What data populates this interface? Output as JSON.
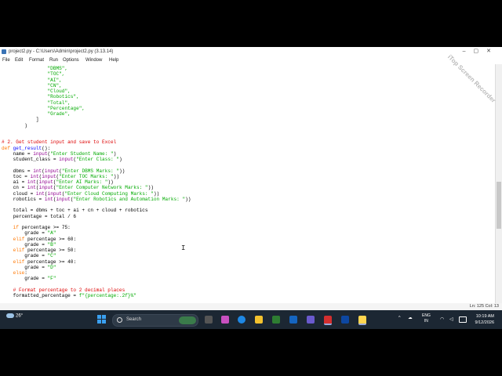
{
  "window": {
    "title": "project2.py - C:\\Users\\Admin\\project2.py (3.13.14)"
  },
  "menu": [
    "File",
    "Edit",
    "Format",
    "Run",
    "Options",
    "Window",
    "Help"
  ],
  "watermark": "iTop Screen Recorder",
  "code": [
    [
      {
        "t": "                \"DBMS\",",
        "c": "str"
      }
    ],
    [
      {
        "t": "                \"TOC\",",
        "c": "str"
      }
    ],
    [
      {
        "t": "                \"AI\",",
        "c": "str"
      }
    ],
    [
      {
        "t": "                \"CN\",",
        "c": "str"
      }
    ],
    [
      {
        "t": "                \"Cloud\",",
        "c": "str"
      }
    ],
    [
      {
        "t": "                \"Robotics\",",
        "c": "str"
      }
    ],
    [
      {
        "t": "                \"Total\",",
        "c": "str"
      }
    ],
    [
      {
        "t": "                \"Percentage\",",
        "c": "str"
      }
    ],
    [
      {
        "t": "                \"Grade\",",
        "c": "str"
      }
    ],
    [
      {
        "t": "            ]",
        "c": ""
      }
    ],
    [
      {
        "t": "        )",
        "c": ""
      }
    ],
    [
      {
        "t": "",
        "c": ""
      }
    ],
    [
      {
        "t": "",
        "c": ""
      }
    ],
    [
      {
        "t": "# 2. Get student input and save to Excel",
        "c": "cmt"
      }
    ],
    [
      {
        "t": "def ",
        "c": "kw"
      },
      {
        "t": "get_result",
        "c": "def"
      },
      {
        "t": "():",
        "c": ""
      }
    ],
    [
      {
        "t": "    name = ",
        "c": ""
      },
      {
        "t": "input",
        "c": "bi"
      },
      {
        "t": "(",
        "c": ""
      },
      {
        "t": "\"Enter Student Name: \"",
        "c": "str"
      },
      {
        "t": ")",
        "c": ""
      }
    ],
    [
      {
        "t": "    student_class = ",
        "c": ""
      },
      {
        "t": "input",
        "c": "bi"
      },
      {
        "t": "(",
        "c": ""
      },
      {
        "t": "\"Enter Class: \"",
        "c": "str"
      },
      {
        "t": ")",
        "c": ""
      }
    ],
    [
      {
        "t": "",
        "c": ""
      }
    ],
    [
      {
        "t": "    dbms = ",
        "c": ""
      },
      {
        "t": "int",
        "c": "bi"
      },
      {
        "t": "(",
        "c": ""
      },
      {
        "t": "input",
        "c": "bi"
      },
      {
        "t": "(",
        "c": ""
      },
      {
        "t": "\"Enter DBMS Marks: \"",
        "c": "str"
      },
      {
        "t": "))",
        "c": ""
      }
    ],
    [
      {
        "t": "    toc = ",
        "c": ""
      },
      {
        "t": "int",
        "c": "bi"
      },
      {
        "t": "(",
        "c": ""
      },
      {
        "t": "input",
        "c": "bi"
      },
      {
        "t": "(",
        "c": ""
      },
      {
        "t": "\"Enter TOC Marks: \"",
        "c": "str"
      },
      {
        "t": "))",
        "c": ""
      }
    ],
    [
      {
        "t": "    ai = ",
        "c": ""
      },
      {
        "t": "int",
        "c": "bi"
      },
      {
        "t": "(",
        "c": ""
      },
      {
        "t": "input",
        "c": "bi"
      },
      {
        "t": "(",
        "c": ""
      },
      {
        "t": "\"Enter AI Marks: \"",
        "c": "str"
      },
      {
        "t": "))",
        "c": ""
      }
    ],
    [
      {
        "t": "    cn = ",
        "c": ""
      },
      {
        "t": "int",
        "c": "bi"
      },
      {
        "t": "(",
        "c": ""
      },
      {
        "t": "input",
        "c": "bi"
      },
      {
        "t": "(",
        "c": ""
      },
      {
        "t": "\"Enter Computer Network Marks: \"",
        "c": "str"
      },
      {
        "t": "))",
        "c": ""
      }
    ],
    [
      {
        "t": "    cloud = ",
        "c": ""
      },
      {
        "t": "int",
        "c": "bi"
      },
      {
        "t": "(",
        "c": ""
      },
      {
        "t": "input",
        "c": "bi"
      },
      {
        "t": "(",
        "c": ""
      },
      {
        "t": "\"Enter Cloud Computing Marks: \"",
        "c": "str"
      },
      {
        "t": "))",
        "c": ""
      }
    ],
    [
      {
        "t": "    robotics = ",
        "c": ""
      },
      {
        "t": "int",
        "c": "bi"
      },
      {
        "t": "(",
        "c": ""
      },
      {
        "t": "input",
        "c": "bi"
      },
      {
        "t": "(",
        "c": ""
      },
      {
        "t": "\"Enter Robotics and Automation Marks: \"",
        "c": "str"
      },
      {
        "t": "))",
        "c": ""
      }
    ],
    [
      {
        "t": "",
        "c": ""
      }
    ],
    [
      {
        "t": "    total = dbms + toc + ai + cn + cloud + robotics",
        "c": ""
      }
    ],
    [
      {
        "t": "    percentage = total / 6",
        "c": ""
      }
    ],
    [
      {
        "t": "",
        "c": ""
      }
    ],
    [
      {
        "t": "    ",
        "c": ""
      },
      {
        "t": "if",
        "c": "kw"
      },
      {
        "t": " percentage >= 75:",
        "c": ""
      }
    ],
    [
      {
        "t": "        grade = ",
        "c": ""
      },
      {
        "t": "\"A\"",
        "c": "str"
      }
    ],
    [
      {
        "t": "    ",
        "c": ""
      },
      {
        "t": "elif",
        "c": "kw"
      },
      {
        "t": " percentage >= 60:",
        "c": ""
      }
    ],
    [
      {
        "t": "        grade = ",
        "c": ""
      },
      {
        "t": "\"B\"",
        "c": "str"
      }
    ],
    [
      {
        "t": "    ",
        "c": ""
      },
      {
        "t": "elif",
        "c": "kw"
      },
      {
        "t": " percentage >= 50:",
        "c": ""
      }
    ],
    [
      {
        "t": "        grade = ",
        "c": ""
      },
      {
        "t": "\"C\"",
        "c": "str"
      }
    ],
    [
      {
        "t": "    ",
        "c": ""
      },
      {
        "t": "elif",
        "c": "kw"
      },
      {
        "t": " percentage >= 40:",
        "c": ""
      }
    ],
    [
      {
        "t": "        grade = ",
        "c": ""
      },
      {
        "t": "\"D\"",
        "c": "str"
      }
    ],
    [
      {
        "t": "    ",
        "c": ""
      },
      {
        "t": "else",
        "c": "kw"
      },
      {
        "t": ":",
        "c": ""
      }
    ],
    [
      {
        "t": "        grade = ",
        "c": ""
      },
      {
        "t": "\"F\"",
        "c": "str"
      }
    ],
    [
      {
        "t": "",
        "c": ""
      }
    ],
    [
      {
        "t": "    # Format percentage to 2 decimal places",
        "c": "cmt"
      }
    ],
    [
      {
        "t": "    formatted_percentage = ",
        "c": ""
      },
      {
        "t": "f\"{percentage:.2f}%\"",
        "c": "str"
      }
    ]
  ],
  "status": {
    "position": "Ln: 125  Col: 13"
  },
  "taskbar": {
    "weather_temp": "26°",
    "search_label": "Search",
    "language_line1": "ENG",
    "language_line2": "IN",
    "time": "10:19 AM",
    "date": "9/12/2026",
    "tray_caret": "^"
  }
}
